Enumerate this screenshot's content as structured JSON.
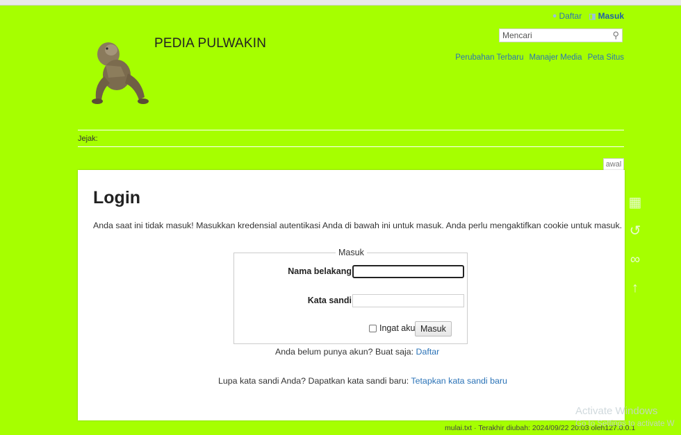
{
  "site": {
    "title": "PEDIA PULWAKIN"
  },
  "user_tools": {
    "register": "Daftar",
    "login": "Masuk"
  },
  "search": {
    "placeholder": "Mencari"
  },
  "site_tools": [
    "Perubahan Terbaru",
    "Manajer Media",
    "Peta Situs"
  ],
  "breadcrumb": {
    "label": "Jejak:"
  },
  "tab": {
    "label": "awal"
  },
  "page": {
    "title": "Login",
    "intro": "Anda saat ini tidak masuk! Masukkan kredensial autentikasi Anda di bawah ini untuk masuk. Anda perlu mengaktifkan cookie untuk masuk."
  },
  "login_form": {
    "legend": "Masuk",
    "username_label": "Nama belakang",
    "username_value": "",
    "password_label": "Kata sandi",
    "password_value": "",
    "remember_label": "Ingat aku",
    "remember_checked": false,
    "submit_label": "Masuk"
  },
  "register_hint": {
    "text": "Anda belum punya akun? Buat saja: ",
    "link": "Daftar"
  },
  "forgot_hint": {
    "text": "Lupa kata sandi Anda? Dapatkan kata sandi baru: ",
    "link": "Tetapkan kata sandi baru"
  },
  "page_tools": [
    {
      "icon": "document-icon"
    },
    {
      "icon": "history-icon"
    },
    {
      "icon": "backlinks-icon"
    },
    {
      "icon": "arrow-up-icon"
    }
  ],
  "footer": {
    "text": "mulai.txt · Terakhir diubah: 2024/09/22 20:03 oleh127.0.0.1"
  },
  "watermark": {
    "line1": "Activate Windows",
    "line2": "Go to Settings to activate W"
  },
  "colors": {
    "background": "#a6ff00",
    "link": "#2b73b7",
    "page": "#ffffff"
  }
}
